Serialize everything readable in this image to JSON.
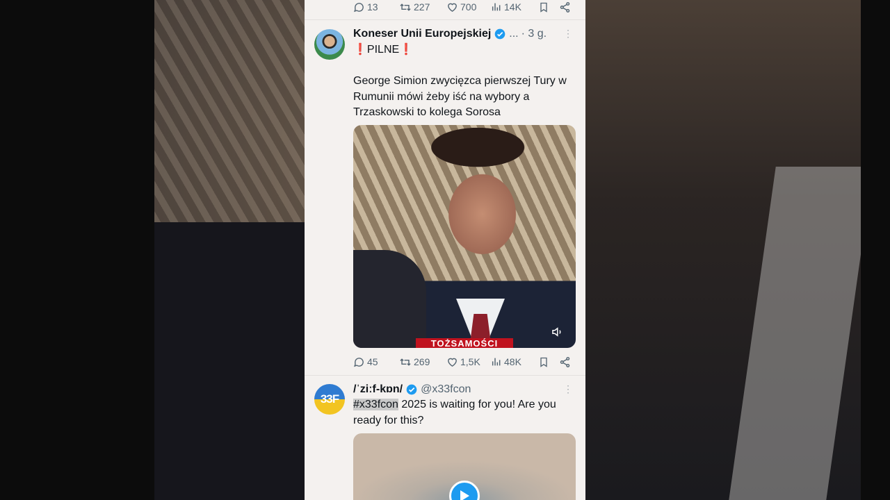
{
  "tweet_prev": {
    "replies": "13",
    "retweets": "227",
    "likes": "700",
    "views": "14K"
  },
  "tweet1": {
    "name": "Koneser Unii Europejskiej",
    "handle": "...",
    "time": "· 3 g.",
    "alert_emoji_left": "❗",
    "alert_label": "PILNE",
    "alert_emoji_right": "❗",
    "body": "George Simion zwycięzca pierwszej Tury w Rumunii mówi żeby iść na wybory a Trzaskowski to kolega Sorosa",
    "video_banner": "TOŻSAMOŚCI",
    "replies": "45",
    "retweets": "269",
    "likes": "1,5K",
    "views": "48K"
  },
  "tweet2": {
    "name": "/ˈziːf-kɒn/",
    "handle": "@x33fcon",
    "avatar_text": "33F",
    "hashtag": "#x33fcon",
    "body": " 2025 is waiting for you! Are you ready for this?"
  },
  "colors": {
    "verified": "#1d9bf0",
    "alert": "#e11d2a",
    "icon_gray": "#536471",
    "page_bg": "#f4f1ef"
  },
  "icons": [
    "reply-icon",
    "retweet-icon",
    "like-icon",
    "views-icon",
    "bookmark-icon",
    "share-icon",
    "verified-icon",
    "more-icon",
    "sound-icon",
    "play-icon"
  ]
}
